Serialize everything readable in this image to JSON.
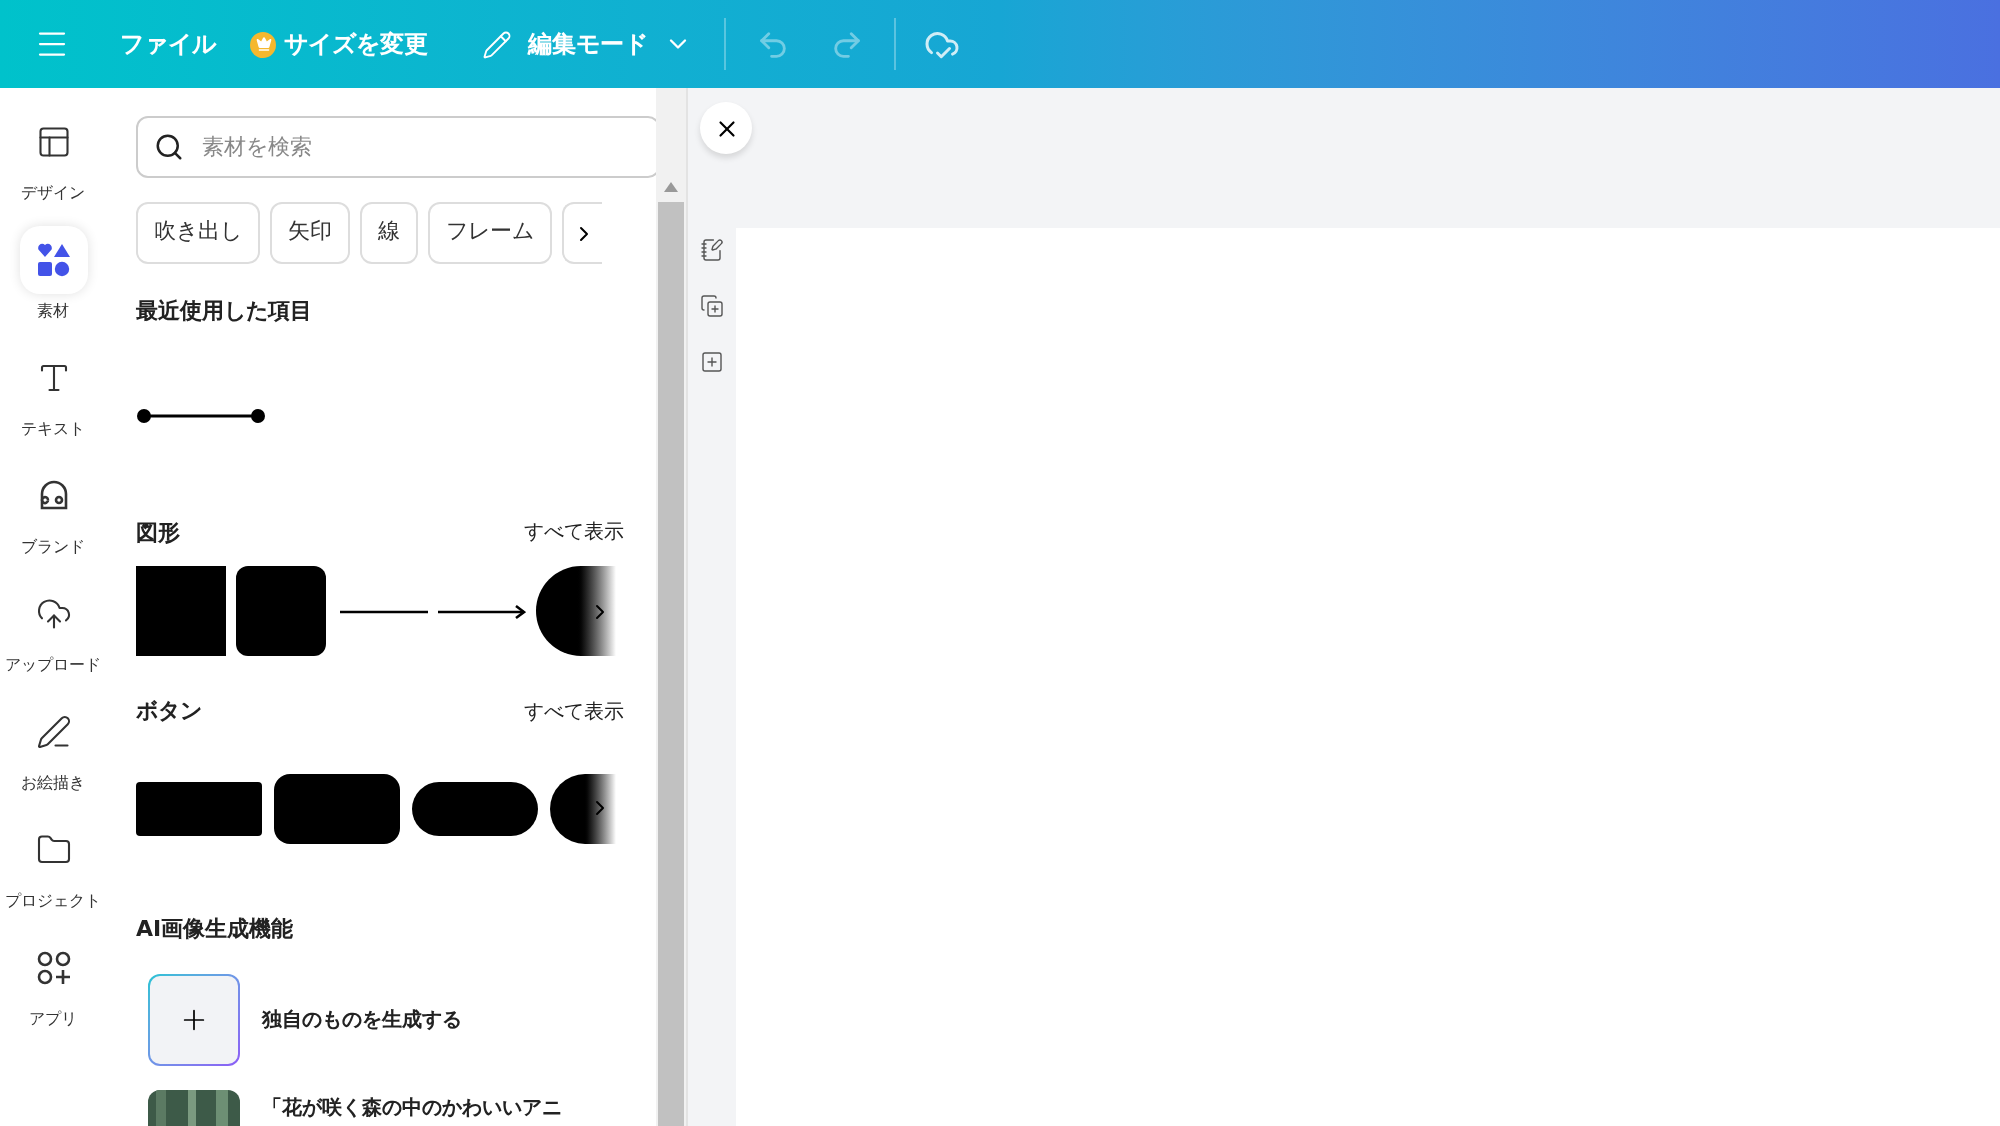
{
  "topbar": {
    "file_menu": "ファイル",
    "resize": "サイズを変更",
    "mode": "編集モード"
  },
  "nav": [
    {
      "label": "デザイン",
      "selected": false
    },
    {
      "label": "素材",
      "selected": true
    },
    {
      "label": "テキスト",
      "selected": false
    },
    {
      "label": "ブランド",
      "selected": false
    },
    {
      "label": "アップロード",
      "selected": false
    },
    {
      "label": "お絵描き",
      "selected": false
    },
    {
      "label": "プロジェクト",
      "selected": false
    },
    {
      "label": "アプリ",
      "selected": false
    }
  ],
  "search": {
    "placeholder": "素材を検索"
  },
  "chips": [
    "吹き出し",
    "矢印",
    "線",
    "フレーム"
  ],
  "recent": {
    "title": "最近使用した項目"
  },
  "shapes": {
    "title": "図形",
    "see_all": "すべて表示"
  },
  "buttons": {
    "title": "ボタン",
    "see_all": "すべて表示"
  },
  "ai": {
    "title": "AI画像生成機能",
    "items": [
      {
        "kind": "create",
        "label": "独自のものを生成する"
      },
      {
        "kind": "picture",
        "label": "「花が咲く森の中のかわいいアニ"
      }
    ]
  }
}
